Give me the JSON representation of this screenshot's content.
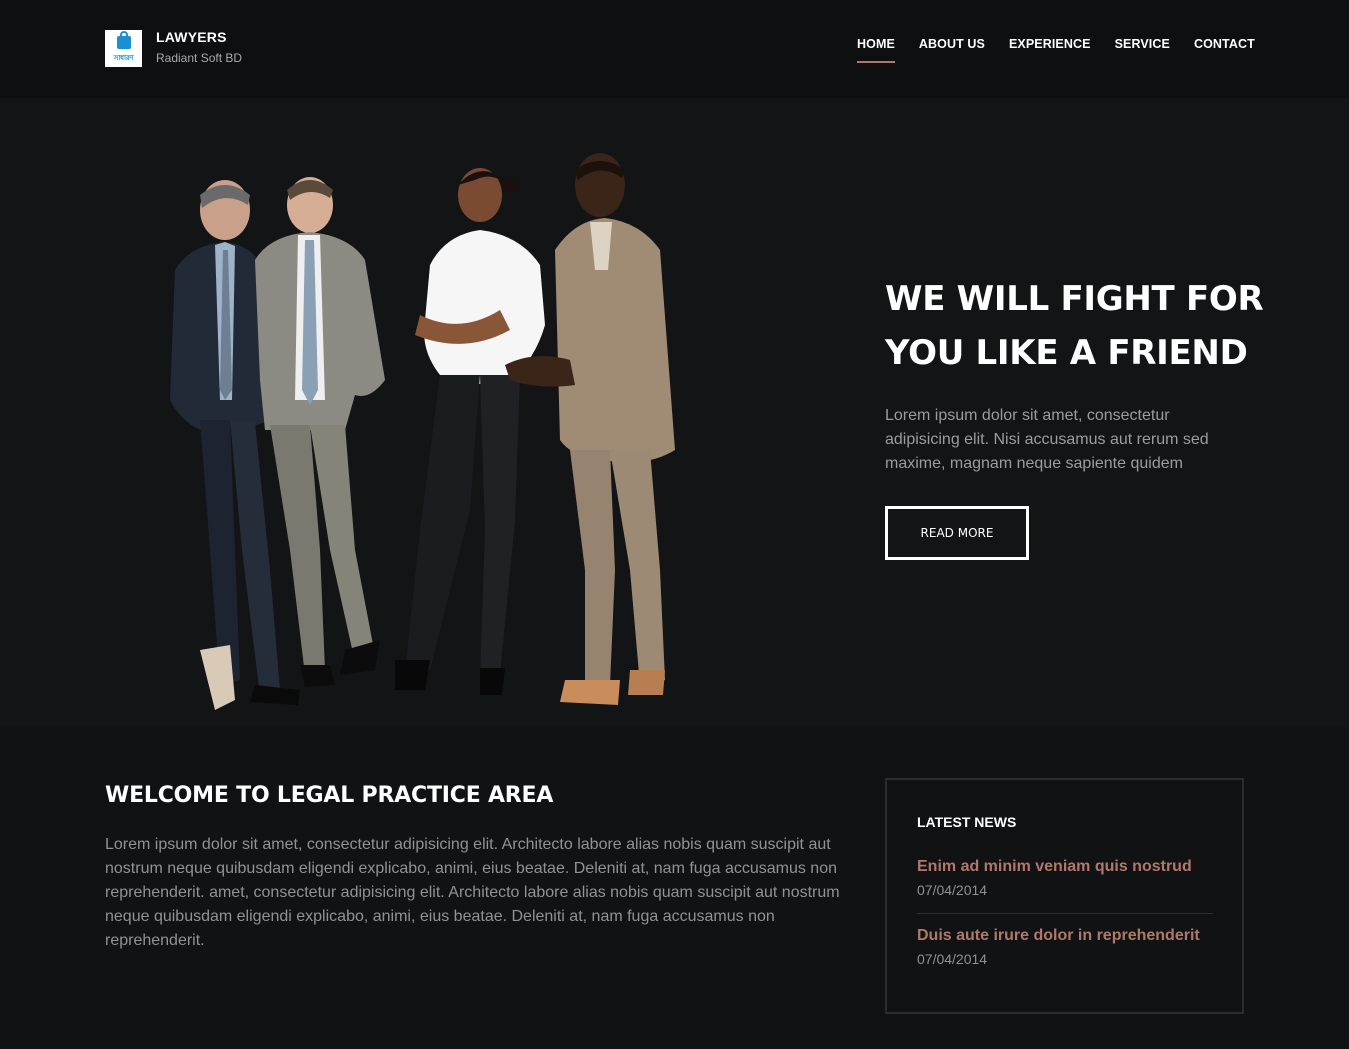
{
  "header": {
    "logo_text": "সাধারণ",
    "brand_name": "LAWYERS",
    "brand_sub": "Radiant Soft BD",
    "nav": [
      {
        "label": "HOME",
        "active": true
      },
      {
        "label": "ABOUT US",
        "active": false
      },
      {
        "label": "EXPERIENCE",
        "active": false
      },
      {
        "label": "SERVICE",
        "active": false
      },
      {
        "label": "CONTACT",
        "active": false
      }
    ]
  },
  "hero": {
    "title": "WE WILL FIGHT FOR YOU LIKE A FRIEND",
    "text": "Lorem ipsum dolor sit amet, consectetur adipisicing elit. Nisi accusamus aut rerum sed maxime, magnam neque sapiente quidem",
    "button_label": "READ MORE"
  },
  "welcome": {
    "title": "WELCOME TO LEGAL PRACTICE AREA",
    "text": "Lorem ipsum dolor sit amet, consectetur adipisicing elit. Architecto labore alias nobis quam suscipit aut nostrum neque quibusdam eligendi explicabo, animi, eius beatae. Deleniti at, nam fuga accusamus non reprehenderit. amet, consectetur adipisicing elit. Architecto labore alias nobis quam suscipit aut nostrum neque quibusdam eligendi explicabo, animi, eius beatae. Deleniti at, nam fuga accusamus non reprehenderit."
  },
  "news": {
    "title": "LATEST NEWS",
    "items": [
      {
        "title": "Enim ad minim veniam quis nostrud",
        "date": "07/04/2014"
      },
      {
        "title": "Duis aute irure dolor in reprehenderit",
        "date": "07/04/2014"
      }
    ]
  },
  "colors": {
    "background": "#131416",
    "header": "#0e0f10",
    "accent": "#b0786a",
    "logo_blue": "#1a8fd6"
  }
}
